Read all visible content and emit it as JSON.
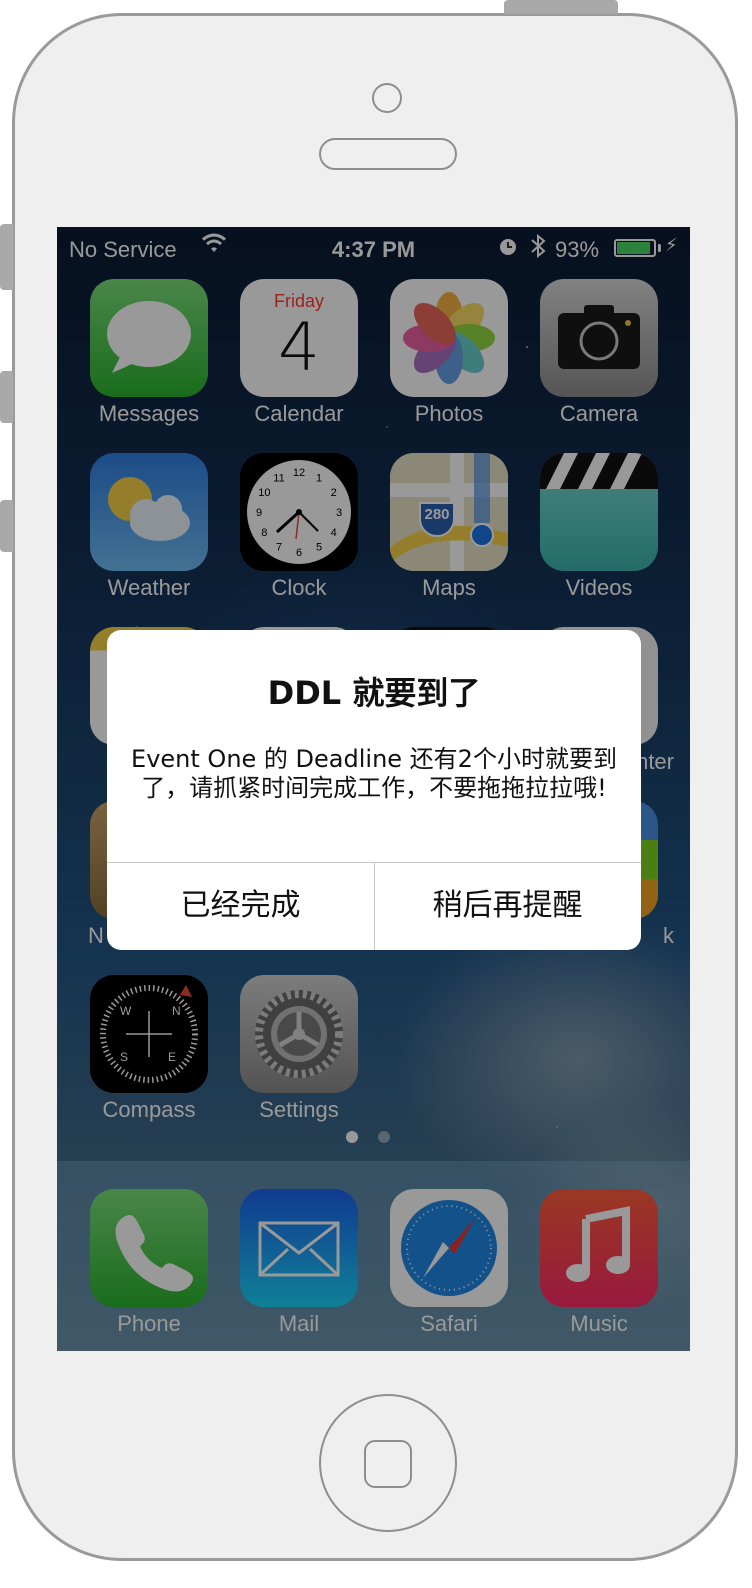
{
  "status_bar": {
    "carrier": "No Service",
    "wifi_icon": "wifi-icon",
    "time": "4:37 PM",
    "alarm_icon": "alarm-icon",
    "bluetooth_icon": "bluetooth-icon",
    "battery_percent": "93%",
    "battery_level": 0.93,
    "charging_icon": "bolt-icon"
  },
  "calendar": {
    "day_name": "Friday",
    "day_number": "4"
  },
  "home_apps": [
    {
      "label": "Messages"
    },
    {
      "label": "Calendar"
    },
    {
      "label": "Photos"
    },
    {
      "label": "Camera"
    },
    {
      "label": "Weather"
    },
    {
      "label": "Clock"
    },
    {
      "label": "Maps"
    },
    {
      "label": "Videos"
    },
    {
      "label": ""
    },
    {
      "label": ""
    },
    {
      "label": ""
    },
    {
      "label": "nter"
    },
    {
      "label": "N"
    },
    {
      "label": ""
    },
    {
      "label": ""
    },
    {
      "label": "k"
    },
    {
      "label": "Compass"
    },
    {
      "label": "Settings"
    }
  ],
  "maps_shield": "280",
  "compass_letters": [
    "N",
    "E",
    "S",
    "W"
  ],
  "clock_numbers": [
    "12",
    "1",
    "2",
    "3",
    "4",
    "5",
    "6",
    "7",
    "8",
    "9",
    "10",
    "11"
  ],
  "page_indicator": {
    "pages": 2,
    "current": 1
  },
  "dock_apps": [
    {
      "label": "Phone"
    },
    {
      "label": "Mail"
    },
    {
      "label": "Safari"
    },
    {
      "label": "Music"
    }
  ],
  "alert": {
    "title": "DDL 就要到了",
    "message": "Event One 的 Deadline 还有2个小时就要到了，请抓紧时间完成工作，不要拖拖拉拉哦!",
    "buttons": [
      {
        "label": "已经完成"
      },
      {
        "label": "稍后再提醒"
      }
    ]
  },
  "colors": {
    "messages": "#4cd964",
    "calendar_red": "#ff3b30",
    "alert_bg": "#ffffff",
    "dim_overlay": "rgba(0,0,0,0.40)"
  }
}
